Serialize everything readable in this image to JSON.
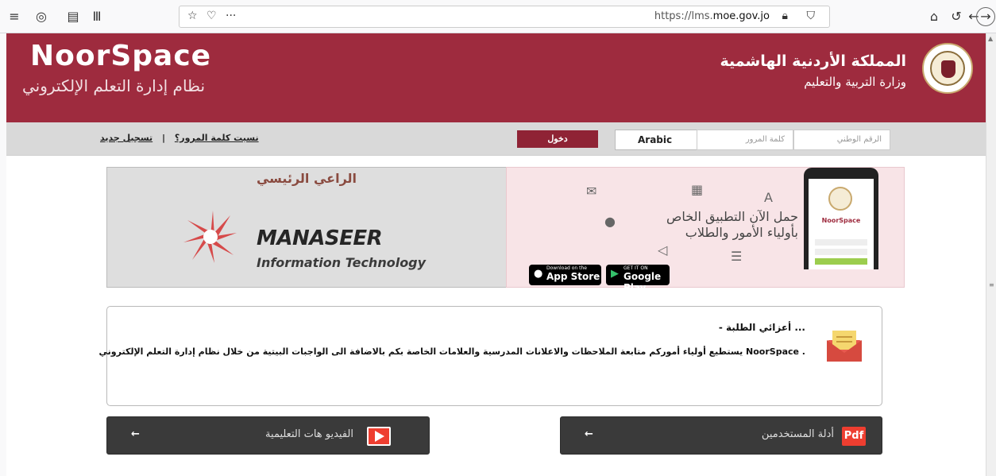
{
  "browser": {
    "url_prefix": "https://lms.",
    "url_domain": "moe.gov.jo",
    "toolbar_icons": [
      "hamburger-menu-icon",
      "extensions-icon",
      "reader-view-icon",
      "library-icon",
      "bookmark-star-icon",
      "pocket-icon",
      "more-actions-icon",
      "lock-icon",
      "tracking-protection-icon",
      "home-icon",
      "reload-icon",
      "back-icon",
      "forward-icon"
    ]
  },
  "header": {
    "brand": "NoorSpace",
    "brand_subtitle": "نظام إدارة التعلم الإلكتروني",
    "kingdom": "المملكة الأردنية الهاشمية",
    "ministry": "وزارة التربية والتعليم"
  },
  "login": {
    "national_id_placeholder": "الرقم الوطني",
    "password_placeholder": "كلمة المرور",
    "language": "Arabic",
    "login_button": "دخول",
    "forgot_password": "نسيت كلمة المرور؟",
    "separator": "|",
    "register": "تسجيل جديد"
  },
  "sponsor": {
    "title": "الراعي الرئيسي",
    "company": "MANASEER",
    "company_sub": "Information Technology"
  },
  "app_promo": {
    "line1": "حمل الآن التطبيق الخاص",
    "line2": "بأولياء الأمور والطلاب",
    "app_store_small": "Download on the",
    "app_store_big": "App Store",
    "google_play_small": "GET IT ON",
    "google_play_big": "Google Play"
  },
  "announcement": {
    "title": "- أعزائي الطلبة ...",
    "text": "يستطيع أولياء أموركم متابعة الملاحظات والاعلانات المدرسية والعلامات الخاصة بكم بالاضافة الى الواجبات البيتية من خلال نظام إدارة التعلم الإلكتروني NoorSpace ."
  },
  "tiles": {
    "user_guides": "أدلة المستخدمين",
    "pdf_badge": "Pdf",
    "videos": "الفيديو هات التعليمية",
    "arrow": "←"
  }
}
